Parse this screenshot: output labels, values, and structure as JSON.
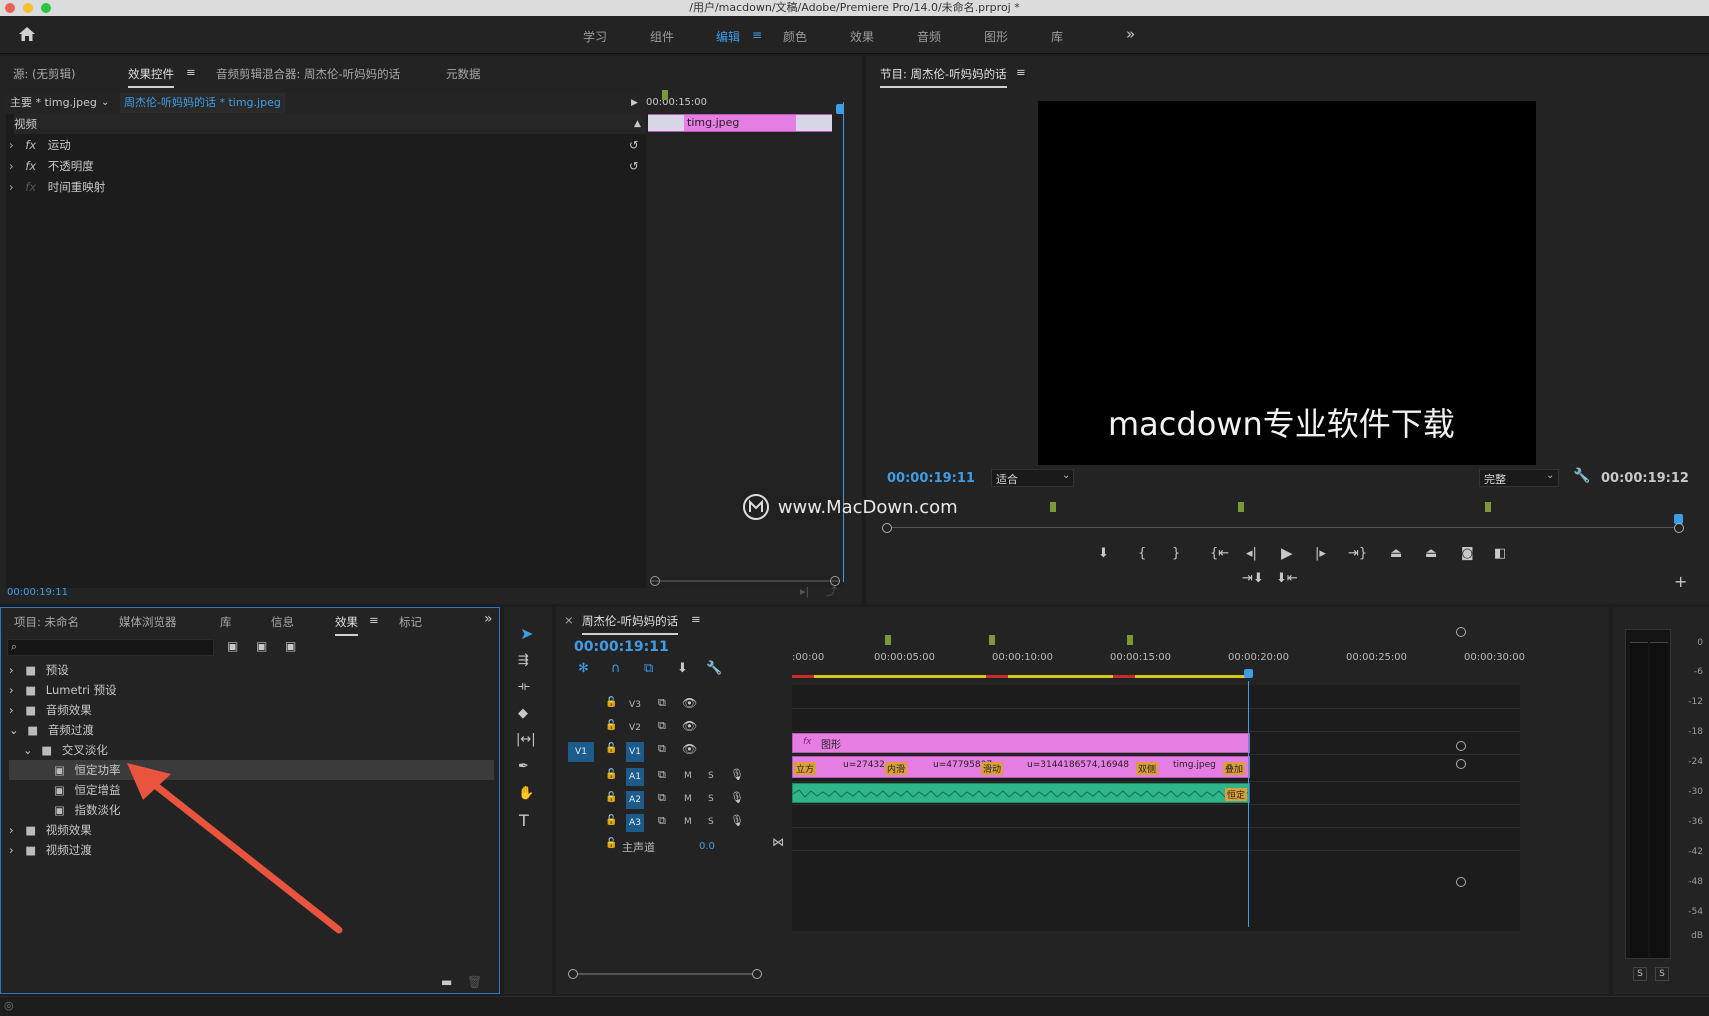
{
  "window": {
    "title": "/用户/macdown/文稿/Adobe/Premiere Pro/14.0/未命名.prproj *"
  },
  "workspaces": {
    "items": [
      "学习",
      "组件",
      "编辑",
      "颜色",
      "效果",
      "音频",
      "图形",
      "库"
    ],
    "active": "编辑",
    "more": "»"
  },
  "source_panel": {
    "tabs": [
      "源: (无剪辑)",
      "效果控件",
      "音频剪辑混合器: 周杰伦-听妈妈的话",
      "元数据"
    ],
    "active_tab": "效果控件",
    "master": "主要 * timg.jpeg",
    "clip": "周杰伦-听妈妈的话 * timg.jpeg",
    "ruler_time": "00:00:15:00",
    "clip_label": "timg.jpeg",
    "section": "视频",
    "effects": [
      "运动",
      "不透明度",
      "时间重映射"
    ],
    "timecode": "00:00:19:11"
  },
  "program_panel": {
    "title": "节目: 周杰伦-听妈妈的话",
    "overlay_text": "macdown专业软件下载",
    "timecode": "00:00:19:11",
    "fit": "适合",
    "quality": "完整",
    "duration": "00:00:19:12",
    "watermark": "www.MacDown.com"
  },
  "project_panel": {
    "tabs": [
      "项目: 未命名",
      "媒体浏览器",
      "库",
      "信息",
      "效果",
      "标记"
    ],
    "active_tab": "效果",
    "search_placeholder": "",
    "tree": [
      {
        "label": "预设",
        "level": 0,
        "expanded": false,
        "type": "folder"
      },
      {
        "label": "Lumetri 预设",
        "level": 0,
        "expanded": false,
        "type": "folder"
      },
      {
        "label": "音频效果",
        "level": 0,
        "expanded": false,
        "type": "folder"
      },
      {
        "label": "音频过渡",
        "level": 0,
        "expanded": true,
        "type": "folder"
      },
      {
        "label": "交叉淡化",
        "level": 1,
        "expanded": true,
        "type": "folder"
      },
      {
        "label": "恒定功率",
        "level": 2,
        "type": "effect",
        "selected": true
      },
      {
        "label": "恒定增益",
        "level": 2,
        "type": "effect"
      },
      {
        "label": "指数淡化",
        "level": 2,
        "type": "effect"
      },
      {
        "label": "视频效果",
        "level": 0,
        "expanded": false,
        "type": "folder"
      },
      {
        "label": "视频过渡",
        "level": 0,
        "expanded": false,
        "type": "folder"
      }
    ]
  },
  "timeline": {
    "title": "周杰伦-听妈妈的话",
    "timecode": "00:00:19:11",
    "ruler": [
      ":00:00",
      "00:00:05:00",
      "00:00:10:00",
      "00:00:15:00",
      "00:00:20:00",
      "00:00:25:00",
      "00:00:30:00"
    ],
    "tracks": {
      "v3": "V3",
      "v2": "V2",
      "v1": "V1",
      "v1_src": "V1",
      "a1": "A1",
      "a2": "A2",
      "a3": "A3",
      "m": "M",
      "s": "S",
      "master": "主声道",
      "master_val": "0.0"
    },
    "clips": {
      "graphic": "图形",
      "v1": [
        "立方",
        "u=27432",
        "内滑",
        "u=47795807",
        "滑动",
        "u=3144186574,16948",
        "双侧",
        "timg.jpeg",
        "叠加"
      ],
      "a1_end": "恒定"
    }
  },
  "meter": {
    "labels": [
      "0",
      "-6",
      "-12",
      "-18",
      "-24",
      "-30",
      "-36",
      "-42",
      "-48",
      "-54",
      "dB"
    ],
    "solo": [
      "S",
      "S"
    ]
  },
  "colors": {
    "accent": "#3f9de6",
    "graphic_clip": "#e67de3",
    "audio_clip": "#2fb58a",
    "arrow": "#e8543e"
  }
}
